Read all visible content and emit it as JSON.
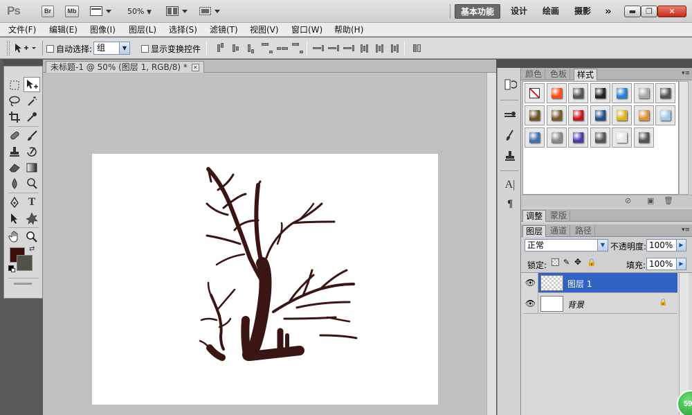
{
  "appbar": {
    "logo": "Ps",
    "bridge": "Br",
    "minibridge": "Mb",
    "zoom": "50%",
    "workspaces": [
      "基本功能",
      "设计",
      "绘画",
      "摄影"
    ],
    "more": "»",
    "win_min": "▬",
    "win_restore": "❐",
    "win_close": "✕"
  },
  "menu": [
    "文件(F)",
    "编辑(E)",
    "图像(I)",
    "图层(L)",
    "选择(S)",
    "滤镜(T)",
    "视图(V)",
    "窗口(W)",
    "帮助(H)"
  ],
  "options": {
    "auto_select_label": "自动选择:",
    "auto_select_value": "组",
    "show_transform_label": "显示变换控件"
  },
  "document": {
    "tab_title": "未标题-1 @ 50% (图层 1, RGB/8) *",
    "close_glyph": "✕"
  },
  "colors": {
    "foreground": "#3a0d08",
    "background": "#4e5247",
    "stroke": "#3b1414",
    "selection": "#3163c5"
  },
  "panels": {
    "top_tabs": [
      "颜色",
      "色板",
      "样式"
    ],
    "active_top_tab": "样式",
    "style_swatches": [
      [
        "none",
        "#ff4a10",
        "#555555",
        "#222222",
        "#2a7fd1",
        "#a8a8a8",
        "#555555"
      ],
      [
        "#6b5425",
        "#7a5a2c",
        "#c2161f",
        "#22508a",
        "#d8b319",
        "#d79138",
        "#9ec7ea"
      ],
      [
        "#3f6fb0",
        "#8a8a8a",
        "#4c3aa8",
        "#555555",
        "#e6e6e6",
        "#555555"
      ]
    ],
    "mid_tabs": [
      "调整",
      "蒙版"
    ],
    "layer_tabs": [
      "图层",
      "通道",
      "路径"
    ],
    "blend_mode": "正常",
    "opacity_label": "不透明度:",
    "opacity_value": "100%",
    "lock_label": "锁定:",
    "fill_label": "填充:",
    "fill_value": "100%",
    "layers": [
      {
        "name": "图层 1",
        "selected": true
      },
      {
        "name": "背景",
        "selected": false,
        "locked": true
      }
    ]
  },
  "badge": "59"
}
